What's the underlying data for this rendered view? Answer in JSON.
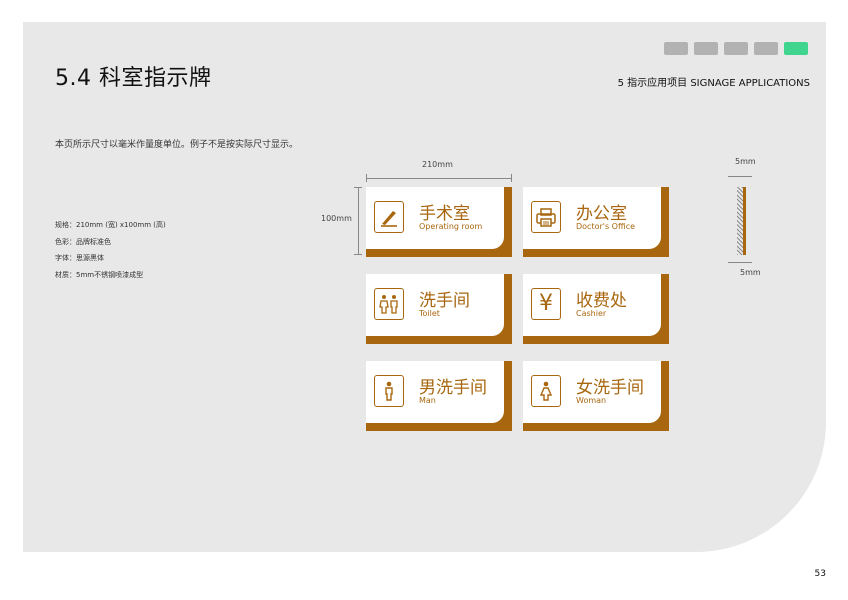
{
  "nav": {
    "tab_count": 5,
    "active_tab": 5,
    "tab_color": "#b2b2b2",
    "active_color": "#3fd58f"
  },
  "header": {
    "title": "5.4 科室指示牌",
    "section": "5 指示应用项目 SIGNAGE APPLICATIONS"
  },
  "note": "本页所示尺寸以毫米作量度单位。例子不是按实际尺寸显示。",
  "specs": [
    "规格：210mm (宽) x100mm (高)",
    "色彩：品牌标准色",
    "字体：思源黑体",
    "材质：5mm不锈钢喷漆成型"
  ],
  "dimensions": {
    "width": "210mm",
    "height": "100mm",
    "thickness_top": "5mm",
    "thickness_bottom": "5mm"
  },
  "signs": [
    {
      "cn": "手术室",
      "en": "Operating room",
      "icon": "scalpel-icon"
    },
    {
      "cn": "办公室",
      "en": "Doctor's Office",
      "icon": "printer-icon"
    },
    {
      "cn": "洗手间",
      "en": "Toilet",
      "icon": "toilet-icon"
    },
    {
      "cn": "收费处",
      "en": "Cashier",
      "icon": "yen-icon",
      "symbol": "¥"
    },
    {
      "cn": "男洗手间",
      "en": "Man",
      "icon": "man-icon"
    },
    {
      "cn": "女洗手间",
      "en": "Woman",
      "icon": "woman-icon"
    }
  ],
  "colors": {
    "brand": "#a8670f",
    "panel": "#e8e8e8"
  },
  "page_number": "53"
}
